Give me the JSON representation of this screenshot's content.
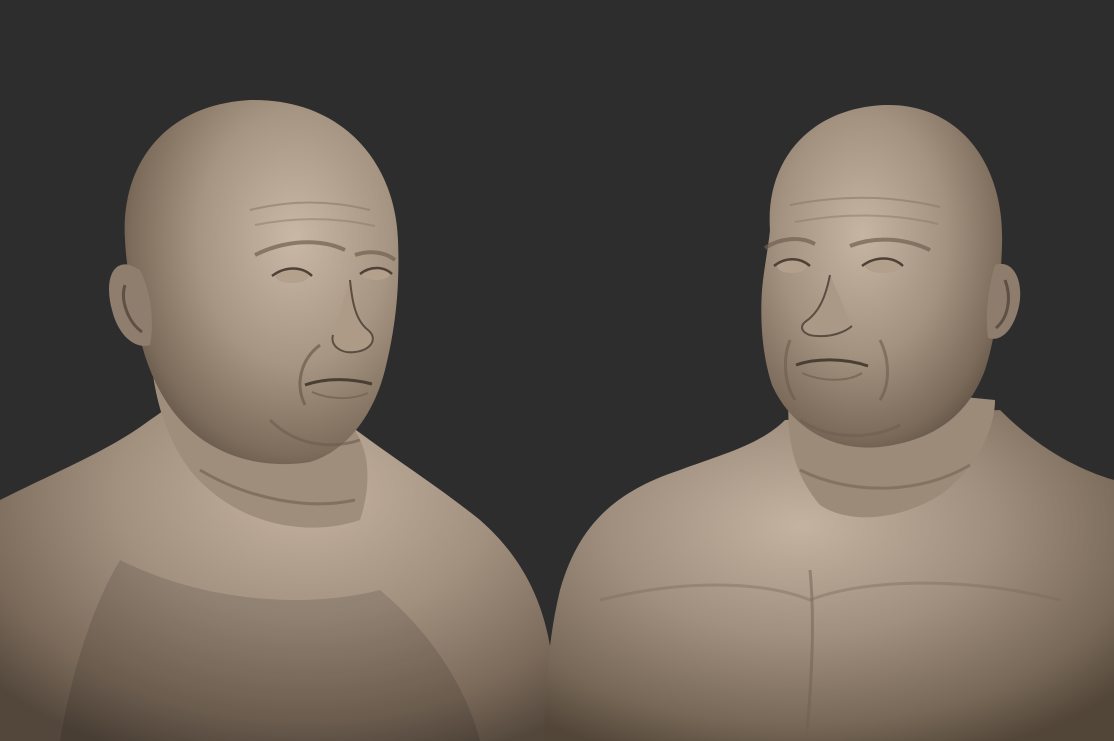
{
  "scene": {
    "background_color": "#2d2d2e",
    "material_base": "#9c8a78",
    "material_highlight": "#c8b7a4",
    "material_shadow": "#4a3f35"
  },
  "views": [
    {
      "subject": "sculpted-bust",
      "angle": "three-quarter-right"
    },
    {
      "subject": "sculpted-bust",
      "angle": "three-quarter-left"
    }
  ]
}
